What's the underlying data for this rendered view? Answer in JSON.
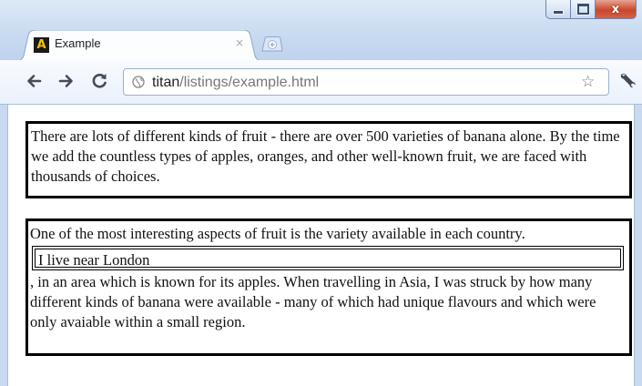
{
  "browser": {
    "tab_title": "Example",
    "tab_close": "×",
    "url_host": "titan",
    "url_path": "/listings/example.html",
    "favicon_letter": "A",
    "caption_close": "x",
    "icons": {
      "back": "back-arrow-icon",
      "forward": "forward-arrow-icon",
      "reload": "reload-icon",
      "page": "globe-page-icon",
      "star": "bookmark-star-icon",
      "wrench": "wrench-menu-icon",
      "new_tab": "new-tab-icon"
    }
  },
  "page": {
    "para1": "There are lots of different kinds of fruit - there are over 500 varieties of banana alone. By the time we add the countless types of apples, oranges, and other well-known fruit, we are faced with thousands of choices.",
    "para2_intro": "One of the most interesting aspects of fruit is the variety available in each country.",
    "inner_box": "I live near London",
    "para2_rest": ", in an area which is known for its apples. When travelling in Asia, I was struck by how many different kinds of banana were available - many of which had unique flavours and which were only avaiable within a small region."
  }
}
